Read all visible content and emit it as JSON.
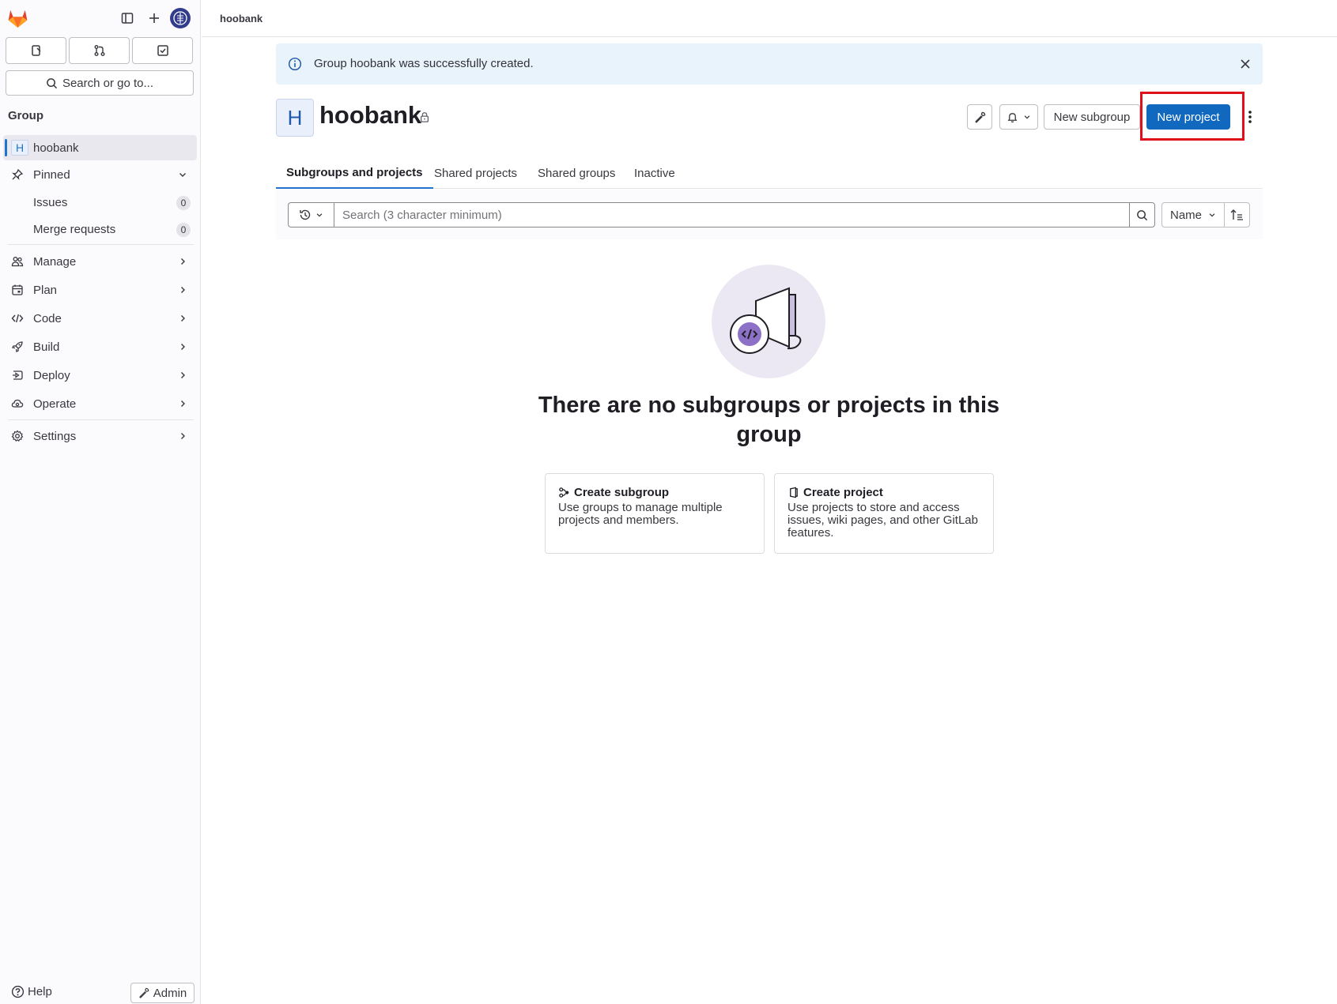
{
  "sidebar": {
    "search_label": "Search or go to...",
    "section_title": "Group",
    "group_initial": "H",
    "group_name": "hoobank",
    "pinned": "Pinned",
    "issues": "Issues",
    "issues_count": "0",
    "merge_requests": "Merge requests",
    "merge_requests_count": "0",
    "nav": {
      "manage": "Manage",
      "plan": "Plan",
      "code": "Code",
      "build": "Build",
      "deploy": "Deploy",
      "operate": "Operate",
      "settings": "Settings"
    },
    "help": "Help",
    "admin": "Admin"
  },
  "breadcrumb": "hoobank",
  "alert": {
    "message": "Group hoobank was successfully created."
  },
  "header": {
    "avatar_initial": "H",
    "title": "hoobank",
    "new_subgroup": "New subgroup",
    "new_project": "New project"
  },
  "tabs": {
    "subgroups_projects": "Subgroups and projects",
    "shared_projects": "Shared projects",
    "shared_groups": "Shared groups",
    "inactive": "Inactive"
  },
  "filter": {
    "search_placeholder": "Search (3 character minimum)",
    "sort_label": "Name"
  },
  "empty_state": {
    "title": "There are no subgroups or projects in this group",
    "cards": {
      "subgroup_title": "Create subgroup",
      "subgroup_desc": "Use groups to manage multiple projects and members.",
      "project_title": "Create project",
      "project_desc": "Use projects to store and access issues, wiki pages, and other GitLab features."
    }
  },
  "colors": {
    "primary": "#1068bf",
    "alert_bg": "#e9f3fc",
    "highlight": "#e0101a"
  }
}
